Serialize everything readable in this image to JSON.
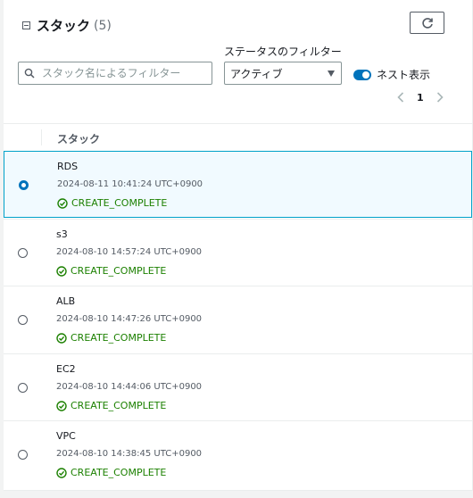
{
  "header": {
    "title": "スタック",
    "count": "(5)"
  },
  "search": {
    "placeholder": "スタック名によるフィルター",
    "value": ""
  },
  "status_filter": {
    "label": "ステータスのフィルター",
    "selected": "アクティブ"
  },
  "nested_toggle": {
    "label": "ネスト表示",
    "on": true
  },
  "pagination": {
    "current_page": "1"
  },
  "table": {
    "column": "スタック",
    "rows": [
      {
        "name": "RDS",
        "time": "2024-08-11 10:41:24 UTC+0900",
        "status": "CREATE_COMPLETE",
        "selected": true
      },
      {
        "name": "s3",
        "time": "2024-08-10 14:57:24 UTC+0900",
        "status": "CREATE_COMPLETE",
        "selected": false
      },
      {
        "name": "ALB",
        "time": "2024-08-10 14:47:26 UTC+0900",
        "status": "CREATE_COMPLETE",
        "selected": false
      },
      {
        "name": "EC2",
        "time": "2024-08-10 14:44:06 UTC+0900",
        "status": "CREATE_COMPLETE",
        "selected": false
      },
      {
        "name": "VPC",
        "time": "2024-08-10 14:38:45 UTC+0900",
        "status": "CREATE_COMPLETE",
        "selected": false
      }
    ]
  },
  "colors": {
    "accent": "#0073bb",
    "success": "#1d8102",
    "selected_border": "#00a1c9",
    "selected_bg": "#f1faff"
  },
  "icons": {
    "collapse": "collapse-icon",
    "refresh": "refresh-icon",
    "search": "search-icon",
    "caret": "caret-down-icon",
    "prev": "chevron-left-icon",
    "next": "chevron-right-icon",
    "status": "check-circle-icon"
  }
}
